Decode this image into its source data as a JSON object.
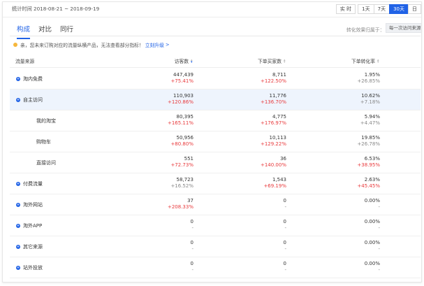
{
  "header": {
    "stat_time": "统计时间 2018-08-21 ~ 2018-09-19",
    "range_buttons": [
      {
        "label": "实 时",
        "active": false
      },
      {
        "label": "1天",
        "active": false
      },
      {
        "label": "7天",
        "active": false
      },
      {
        "label": "30天",
        "active": true
      },
      {
        "label": "日",
        "active": false
      }
    ]
  },
  "tabs": [
    {
      "label": "构成",
      "active": true
    },
    {
      "label": "对比",
      "active": false
    },
    {
      "label": "同行",
      "active": false
    }
  ],
  "conversion": {
    "label": "转化效果归属于：",
    "select_value": "每一次访问来源"
  },
  "notice": {
    "text": "亲，您未来订购对应的流量纵横产品，无法查看部分指标！",
    "link": "立刻升级",
    "arrow": ">"
  },
  "table": {
    "columns": {
      "source": "流量来源",
      "visitors": "访客数",
      "buyers": "下单买家数",
      "conversion": "下单转化率"
    },
    "rows": [
      {
        "name": "淘内免费",
        "level": 0,
        "expandable": true,
        "highlight": false,
        "visitors": "447,439",
        "visitors_change": "+75.41%",
        "visitors_dir": "pos",
        "buyers": "8,711",
        "buyers_change": "+122.50%",
        "buyers_dir": "pos",
        "conversion": "1.95%",
        "conversion_change": "+26.85%",
        "conversion_dir": "neg"
      },
      {
        "name": "自主访问",
        "level": 0,
        "expandable": true,
        "highlight": true,
        "visitors": "110,903",
        "visitors_change": "+120.86%",
        "visitors_dir": "pos",
        "buyers": "11,776",
        "buyers_change": "+136.70%",
        "buyers_dir": "pos",
        "conversion": "10.62%",
        "conversion_change": "+7.18%",
        "conversion_dir": "neg"
      },
      {
        "name": "我的淘宝",
        "level": 1,
        "expandable": false,
        "highlight": false,
        "visitors": "80,395",
        "visitors_change": "+165.11%",
        "visitors_dir": "pos",
        "buyers": "4,775",
        "buyers_change": "+176.97%",
        "buyers_dir": "pos",
        "conversion": "5.94%",
        "conversion_change": "+4.47%",
        "conversion_dir": "neg"
      },
      {
        "name": "购物车",
        "level": 1,
        "expandable": false,
        "highlight": false,
        "visitors": "50,956",
        "visitors_change": "+80.80%",
        "visitors_dir": "pos",
        "buyers": "10,113",
        "buyers_change": "+129.22%",
        "buyers_dir": "pos",
        "conversion": "19.85%",
        "conversion_change": "+26.78%",
        "conversion_dir": "neg"
      },
      {
        "name": "直接访问",
        "level": 1,
        "expandable": false,
        "highlight": false,
        "visitors": "551",
        "visitors_change": "+72.73%",
        "visitors_dir": "pos",
        "buyers": "36",
        "buyers_change": "+140.00%",
        "buyers_dir": "pos",
        "conversion": "6.53%",
        "conversion_change": "+38.95%",
        "conversion_dir": "pos"
      },
      {
        "name": "付费流量",
        "level": 0,
        "expandable": true,
        "highlight": false,
        "visitors": "58,723",
        "visitors_change": "+16.52%",
        "visitors_dir": "neg",
        "buyers": "1,543",
        "buyers_change": "+69.19%",
        "buyers_dir": "pos",
        "conversion": "2.63%",
        "conversion_change": "+45.45%",
        "conversion_dir": "pos"
      },
      {
        "name": "淘外网站",
        "level": 0,
        "expandable": true,
        "highlight": false,
        "visitors": "37",
        "visitors_change": "+208.33%",
        "visitors_dir": "pos",
        "buyers": "0",
        "buyers_change": "-",
        "buyers_dir": "neg",
        "conversion": "0.00%",
        "conversion_change": "-",
        "conversion_dir": "neg"
      },
      {
        "name": "淘外APP",
        "level": 0,
        "expandable": true,
        "highlight": false,
        "visitors": "0",
        "visitors_change": "-",
        "visitors_dir": "neg",
        "buyers": "0",
        "buyers_change": "-",
        "buyers_dir": "neg",
        "conversion": "0.00%",
        "conversion_change": "-",
        "conversion_dir": "neg"
      },
      {
        "name": "其它来源",
        "level": 0,
        "expandable": true,
        "highlight": false,
        "visitors": "0",
        "visitors_change": "-",
        "visitors_dir": "neg",
        "buyers": "0",
        "buyers_change": "-",
        "buyers_dir": "neg",
        "conversion": "0.00%",
        "conversion_change": "-",
        "conversion_dir": "neg"
      },
      {
        "name": "站外投放",
        "level": 0,
        "expandable": true,
        "highlight": false,
        "visitors": "0",
        "visitors_change": "-",
        "visitors_dir": "neg",
        "buyers": "0",
        "buyers_change": "-",
        "buyers_dir": "neg",
        "conversion": "0.00%",
        "conversion_change": "-",
        "conversion_dir": "neg"
      }
    ]
  },
  "colors": {
    "accent": "#2062e6",
    "positive": "#e8393b",
    "muted": "#888888",
    "highlight_row": "#eef4fd"
  }
}
